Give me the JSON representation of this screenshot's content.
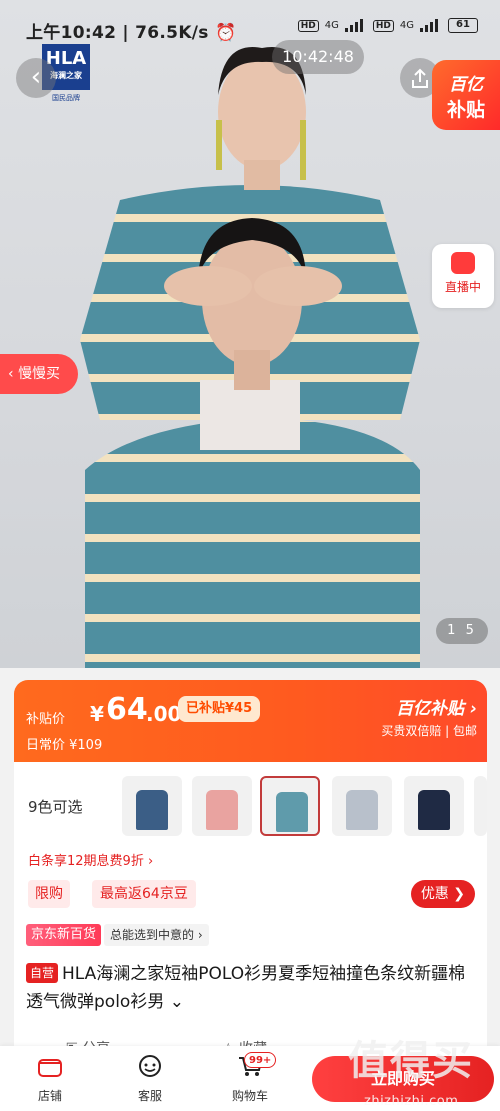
{
  "status": {
    "time": "上午10:42",
    "speed": "76.5K/s",
    "net1": "4G",
    "net2": "4G",
    "hd": "HD",
    "battery": "61"
  },
  "brand_logo": {
    "main": "HLA",
    "cn": "海澜之家",
    "sub": "国民品牌"
  },
  "overlay": {
    "time": "10:42:48",
    "subsidy_line1": "百亿",
    "subsidy_line2": "补贴",
    "live_label": "直播中",
    "slow_label": "慢慢买",
    "pager_current": "1",
    "pager_total": "5"
  },
  "price": {
    "label": "补贴价",
    "currency": "¥",
    "integer": "64",
    "decimal": ".00",
    "subsidized": "已补贴¥45",
    "daily": "日常价 ¥109",
    "brand": "百亿补贴",
    "slogan": "买贵双倍赔 | 包邮"
  },
  "product": {
    "colors_label": "9色可选",
    "installment": "白条享12期息费9折 ›",
    "tag_limit": "限购",
    "tag_rebate": "最高返64京豆",
    "coupon_label": "优惠 ❯",
    "store_badge": "京东新百货",
    "store_tag": "总能选到中意的 ›",
    "self_badge": "自营",
    "title": "HLA海澜之家短袖POLO衫男夏季短袖撞色条纹新疆棉透气微弹polo衫男 ⌄",
    "share": "分享",
    "collect": "收藏"
  },
  "swatches": [
    {
      "color": "#3b5e86"
    },
    {
      "color": "#e9a3a0"
    },
    {
      "color": "#5f9bab"
    },
    {
      "color": "#b8c0cb"
    },
    {
      "color": "#1f2a44"
    },
    {
      "color": "#8fa7b5"
    }
  ],
  "bottom_bar": {
    "store": "店铺",
    "service": "客服",
    "cart": "购物车",
    "cart_count": "99+",
    "buy": "立即购买"
  },
  "watermark": {
    "big": "值得买",
    "small": "zhizhizhi.com"
  }
}
